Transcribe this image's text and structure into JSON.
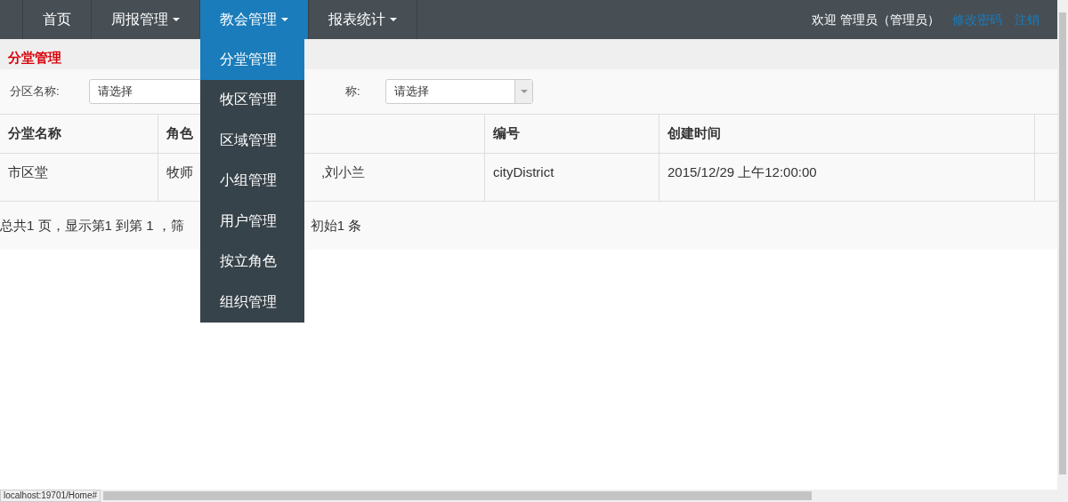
{
  "navbar": {
    "items": [
      {
        "label": "首页",
        "dropdown": false,
        "selected": false
      },
      {
        "label": "周报管理",
        "dropdown": true,
        "selected": false
      },
      {
        "label": "教会管理",
        "dropdown": true,
        "selected": true
      },
      {
        "label": "报表统计",
        "dropdown": true,
        "selected": false
      }
    ],
    "welcome": "欢迎 管理员（管理员）",
    "links": [
      "修改密码",
      "注销"
    ]
  },
  "dropdown_menu": [
    {
      "label": "分堂管理",
      "selected": true
    },
    {
      "label": "牧区管理",
      "selected": false
    },
    {
      "label": "区域管理",
      "selected": false
    },
    {
      "label": "小组管理",
      "selected": false
    },
    {
      "label": "用户管理",
      "selected": false
    },
    {
      "label": "按立角色",
      "selected": false
    },
    {
      "label": "组织管理",
      "selected": false
    }
  ],
  "page_title": "分堂管理",
  "filters": [
    {
      "label": "分区名称:",
      "placeholder": "请选择"
    },
    {
      "label": "称:",
      "placeholder": "请选择"
    }
  ],
  "table": {
    "columns": [
      "分堂名称",
      "角色",
      "",
      "编号",
      "创建时间",
      ""
    ],
    "rows": [
      [
        "市区堂",
        "牧师",
        ",刘小兰",
        "cityDistrict",
        "2015/12/29 上午12:00:00",
        ""
      ]
    ]
  },
  "pager": [
    "总共1 页，显示第1 到第 1 ，筛",
    "初始1 条"
  ],
  "status_bar": "localhost:19701/Home#"
}
